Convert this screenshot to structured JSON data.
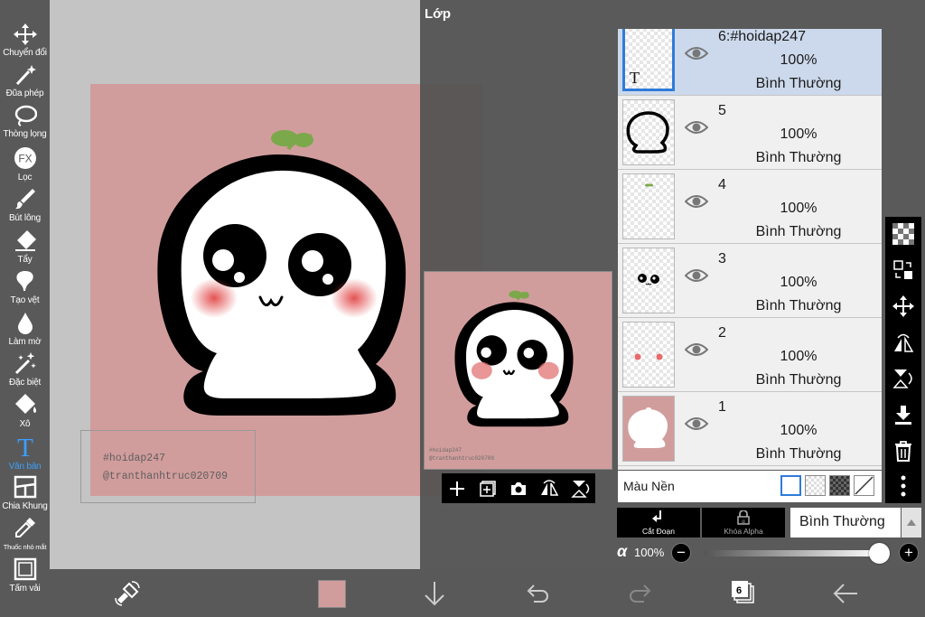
{
  "toolbar": {
    "tools": [
      {
        "label": "Chuyển đổi",
        "icon": "move-arrows-icon"
      },
      {
        "label": "Đũa phép",
        "icon": "magic-wand-icon"
      },
      {
        "label": "Thòng lọng",
        "icon": "lasso-icon"
      },
      {
        "label": "Lọc",
        "icon": "fx-filter-icon"
      },
      {
        "label": "Bút lông",
        "icon": "brush-icon"
      },
      {
        "label": "Tẩy",
        "icon": "eraser-icon"
      },
      {
        "label": "Tạo vệt",
        "icon": "smudge-icon"
      },
      {
        "label": "Làm mờ",
        "icon": "blur-drop-icon"
      },
      {
        "label": "Đặc biệt",
        "icon": "special-wand-icon"
      },
      {
        "label": "Xô",
        "icon": "bucket-icon"
      },
      {
        "label": "Văn bản",
        "icon": "text-tool-icon"
      },
      {
        "label": "Chia Khung",
        "icon": "frame-divider-icon"
      },
      {
        "label": "Thuốc nhỏ mắt",
        "icon": "eyedropper-icon"
      },
      {
        "label": "Tấm vải",
        "icon": "canvas-icon"
      }
    ],
    "active_tool": "Văn bản"
  },
  "canvas": {
    "watermark_lines": [
      "#hoidap247",
      "@tranthanhtruc020709"
    ],
    "background_color": "#d19d9c"
  },
  "layer_panel": {
    "title": "Lớp",
    "layers": [
      {
        "name": "6:#hoidap247",
        "opacity": "100%",
        "blend": "Bình Thường",
        "selected": true
      },
      {
        "name": "5",
        "opacity": "100%",
        "blend": "Bình Thường",
        "selected": false
      },
      {
        "name": "4",
        "opacity": "100%",
        "blend": "Bình Thường",
        "selected": false
      },
      {
        "name": "3",
        "opacity": "100%",
        "blend": "Bình Thường",
        "selected": false
      },
      {
        "name": "2",
        "opacity": "100%",
        "blend": "Bình Thường",
        "selected": false
      },
      {
        "name": "1",
        "opacity": "100%",
        "blend": "Bình Thường",
        "selected": false
      }
    ],
    "background_label": "Màu Nền",
    "clipping_label": "Cắt Đoạn",
    "alpha_lock_label": "Khóa Alpha",
    "blend_mode": "Bình Thường",
    "alpha_symbol": "α",
    "opacity_value": "100%",
    "opacity_fraction": 1.0,
    "minus": "−",
    "plus": "+"
  },
  "bottom_bar": {
    "layer_count": "6",
    "color_swatch": "#d19d9c"
  },
  "colors": {
    "accent": "#3aa0ff",
    "selected_layer": "#ccd9ec",
    "toolbar": "#595959"
  }
}
